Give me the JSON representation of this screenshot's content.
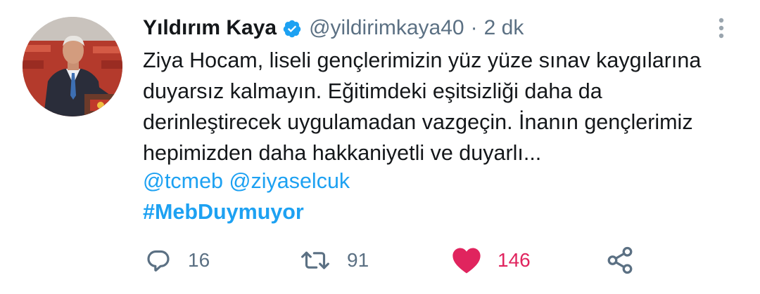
{
  "author": {
    "name": "Yıldırım Kaya",
    "handle": "@yildirimkaya40",
    "separator": "·",
    "time": "2 dk"
  },
  "tweet": {
    "lines": [
      "Ziya Hocam, liseli gençlerimizin yüz yüze sınav kaygılarına",
      "duyarsız kalmayın. Eğitimdeki eşitsizliği daha da",
      "derinleştirecek uygulamadan vazgeçin. İnanın gençlerimiz",
      "hepimizden daha hakkaniyetli ve duyarlı..."
    ],
    "mentions": [
      "@tcmeb",
      "@ziyaselcuk"
    ],
    "hashtag": "#MebDuymuyor"
  },
  "actions": {
    "reply_count": "16",
    "retweet_count": "91",
    "like_count": "146"
  },
  "colors": {
    "link": "#1da1f2",
    "like": "#e0245e",
    "muted": "#5b7083",
    "text": "#14171a"
  },
  "icons": {
    "verified": "verified-badge-icon",
    "more": "more-vertical-icon",
    "reply": "reply-bubble-icon",
    "retweet": "retweet-icon",
    "like": "heart-filled-icon",
    "share": "share-icon"
  }
}
